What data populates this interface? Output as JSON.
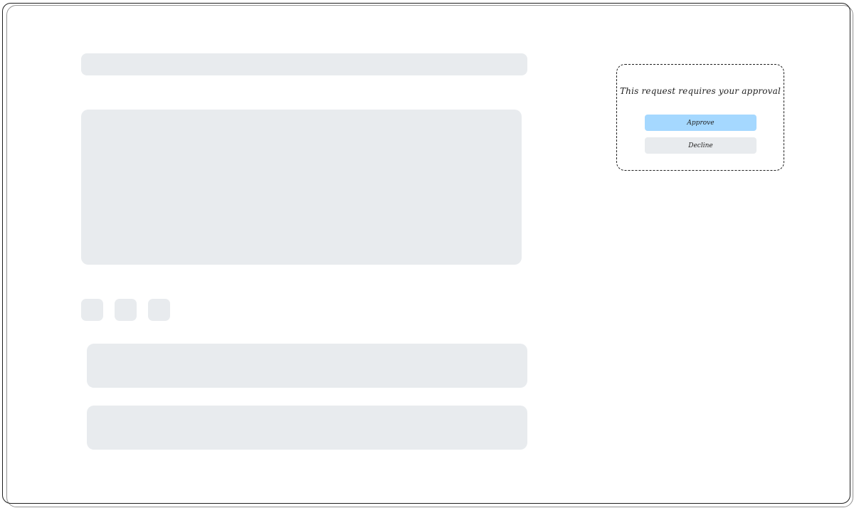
{
  "approval": {
    "message": "This request requires your approval",
    "approve_label": "Approve",
    "decline_label": "Decline"
  },
  "colors": {
    "placeholder": "#e8ebee",
    "approve_button": "#a5d8ff",
    "decline_button": "#e8ebee",
    "stroke": "#1e1e1e"
  }
}
